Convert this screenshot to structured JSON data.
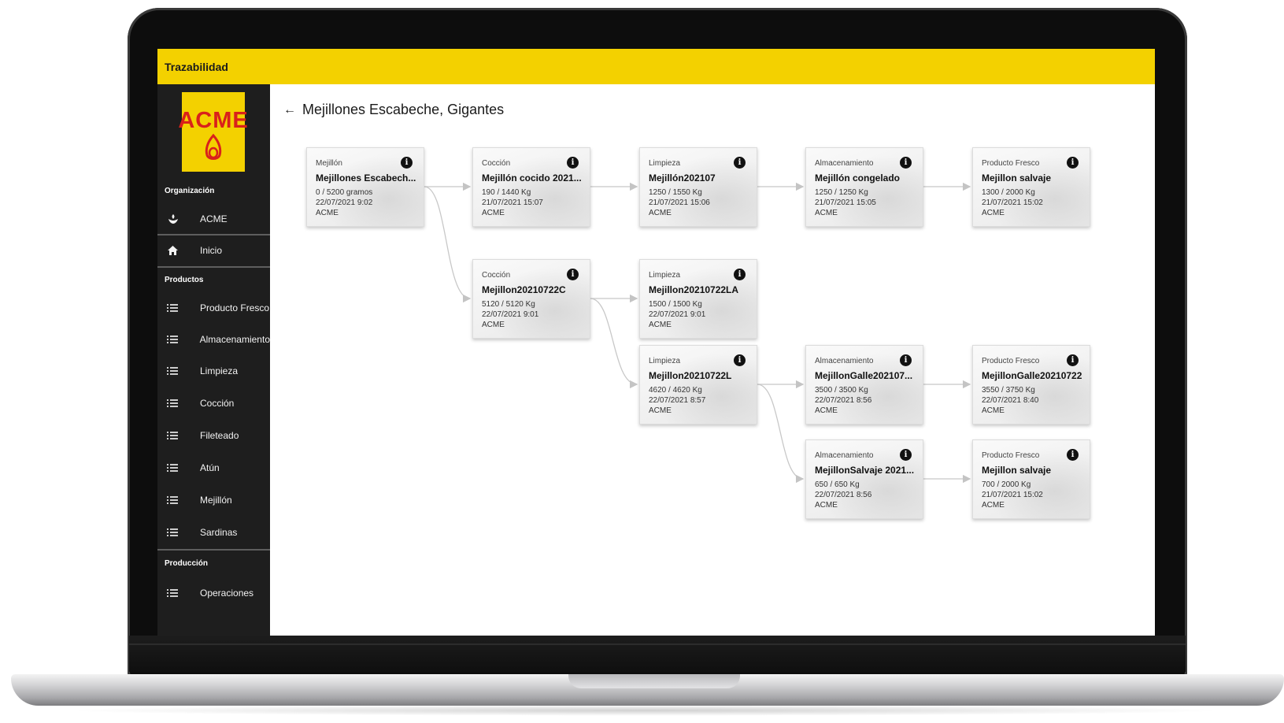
{
  "header": {
    "title": "Trazabilidad"
  },
  "logo": {
    "text": "ACME"
  },
  "sidebar": {
    "organization_label": "Organización",
    "organization_item": "ACME",
    "home_item": "Inicio",
    "products_label": "Productos",
    "product_items": [
      "Producto Fresco",
      "Almacenamiento",
      "Limpieza",
      "Cocción",
      "Fileteado",
      "Atún",
      "Mejillón",
      "Sardinas"
    ],
    "production_label": "Producción",
    "production_items": [
      "Operaciones"
    ]
  },
  "page": {
    "back_icon": "←",
    "title": "Mejillones Escabeche, Gigantes"
  },
  "nodes": [
    {
      "category": "Mejillón",
      "name": "Mejillones Escabech...",
      "quantity": "0 / 5200 gramos",
      "date": "22/07/2021 9:02",
      "org": "ACME"
    },
    {
      "category": "Cocción",
      "name": "Mejillón cocido 2021...",
      "quantity": "190 / 1440 Kg",
      "date": "21/07/2021 15:07",
      "org": "ACME"
    },
    {
      "category": "Limpieza",
      "name": "Mejillón202107",
      "quantity": "1250 / 1550 Kg",
      "date": "21/07/2021 15:06",
      "org": "ACME"
    },
    {
      "category": "Almacenamiento",
      "name": "Mejillón congelado",
      "quantity": "1250 / 1250 Kg",
      "date": "21/07/2021 15:05",
      "org": "ACME"
    },
    {
      "category": "Producto Fresco",
      "name": "Mejillon salvaje",
      "quantity": "1300 / 2000 Kg",
      "date": "21/07/2021 15:02",
      "org": "ACME"
    },
    {
      "category": "Cocción",
      "name": "Mejillon20210722C",
      "quantity": "5120 / 5120 Kg",
      "date": "22/07/2021 9:01",
      "org": "ACME"
    },
    {
      "category": "Limpieza",
      "name": "Mejillon20210722LA",
      "quantity": "1500 / 1500 Kg",
      "date": "22/07/2021 9:01",
      "org": "ACME"
    },
    {
      "category": "Limpieza",
      "name": "Mejillon20210722L",
      "quantity": "4620 / 4620 Kg",
      "date": "22/07/2021 8:57",
      "org": "ACME"
    },
    {
      "category": "Almacenamiento",
      "name": "MejillonGalle202107...",
      "quantity": "3500 / 3500 Kg",
      "date": "22/07/2021 8:56",
      "org": "ACME"
    },
    {
      "category": "Producto Fresco",
      "name": "MejillonGalle20210722",
      "quantity": "3550 / 3750 Kg",
      "date": "22/07/2021 8:40",
      "org": "ACME"
    },
    {
      "category": "Almacenamiento",
      "name": "MejillonSalvaje 2021...",
      "quantity": "650 / 650 Kg",
      "date": "22/07/2021 8:56",
      "org": "ACME"
    },
    {
      "category": "Producto Fresco",
      "name": "Mejillon salvaje",
      "quantity": "700 / 2000 Kg",
      "date": "21/07/2021 15:02",
      "org": "ACME"
    }
  ],
  "icons": {
    "organization": "hand-sprout-icon",
    "home": "home-icon",
    "list": "list-icon",
    "info": "info-icon",
    "back": "arrow-left-icon"
  },
  "colors": {
    "accent": "#f3d100",
    "sidebar": "#1e1e1e",
    "logo_red": "#d9211b"
  }
}
